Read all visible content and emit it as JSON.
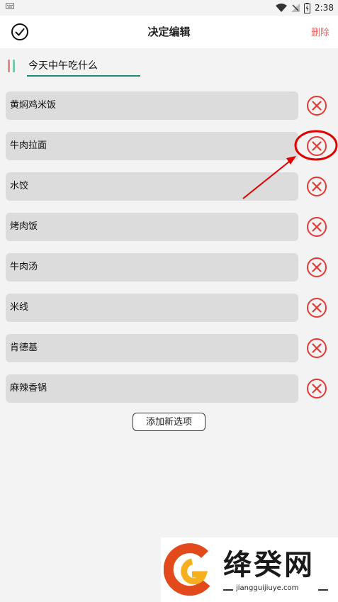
{
  "status_bar": {
    "time": "2:38"
  },
  "header": {
    "title": "决定编辑",
    "delete_label": "删除",
    "confirm_icon": "check-circle-icon"
  },
  "decision": {
    "title_value": "今天中午吃什么"
  },
  "options": [
    {
      "label": "黄焖鸡米饭"
    },
    {
      "label": "牛肉拉面"
    },
    {
      "label": "水饺"
    },
    {
      "label": "烤肉饭"
    },
    {
      "label": "牛肉汤"
    },
    {
      "label": "米线"
    },
    {
      "label": "肯德基"
    },
    {
      "label": "麻辣香锅"
    }
  ],
  "add_button": {
    "label": "添加新选项"
  },
  "watermark": {
    "brand": "绛癸网",
    "url": "jiangguijiuye.com"
  },
  "colors": {
    "remove_red": "#e53935",
    "accent_teal": "#1f8a7a",
    "delete_red": "#e86a6a"
  }
}
